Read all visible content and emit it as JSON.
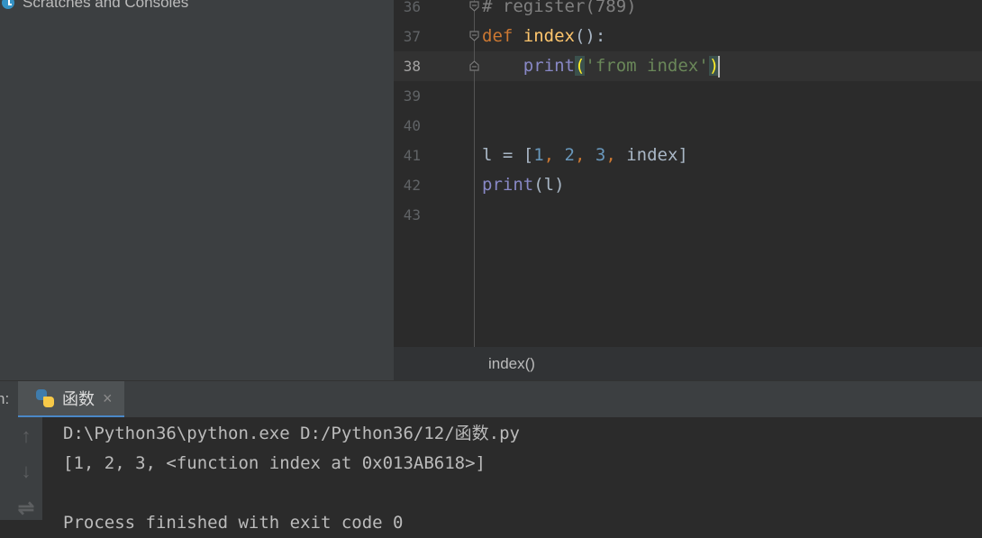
{
  "project": {
    "tree_item_label": "Scratches and Consoles",
    "tree_item_icon": "scratches-icon"
  },
  "editor": {
    "line_numbers": [
      "36",
      "37",
      "38",
      "39",
      "40",
      "41",
      "42",
      "43"
    ],
    "current_line": "38",
    "lines": [
      {
        "number": "36",
        "tokens": [
          {
            "t": "# register(789)",
            "c": "cmt"
          }
        ]
      },
      {
        "number": "37",
        "tokens": [
          {
            "t": "def",
            "c": "kw"
          },
          {
            "t": " "
          },
          {
            "t": "index",
            "c": "fn"
          },
          {
            "t": "():"
          }
        ]
      },
      {
        "number": "38",
        "tokens": [
          {
            "t": "    "
          },
          {
            "t": "print",
            "c": "bi"
          },
          {
            "t": "(",
            "c": "br"
          },
          {
            "t": "'from index'",
            "c": "str"
          },
          {
            "t": ")",
            "c": "br"
          }
        ]
      },
      {
        "number": "39",
        "tokens": []
      },
      {
        "number": "40",
        "tokens": []
      },
      {
        "number": "41",
        "tokens": [
          {
            "t": "l = ["
          },
          {
            "t": "1",
            "c": "num"
          },
          {
            "t": ", ",
            "c": "kw"
          },
          {
            "t": "2",
            "c": "num"
          },
          {
            "t": ", ",
            "c": "kw"
          },
          {
            "t": "3",
            "c": "num"
          },
          {
            "t": ", ",
            "c": "kw"
          },
          {
            "t": "index]"
          }
        ]
      },
      {
        "number": "42",
        "tokens": [
          {
            "t": "print",
            "c": "bi"
          },
          {
            "t": "(l)"
          }
        ]
      },
      {
        "number": "43",
        "tokens": []
      }
    ],
    "breadcrumb": "index()"
  },
  "run": {
    "label": "n:",
    "tab_label": "函数",
    "tab_close": "×",
    "tab_icon": "python-icon",
    "tool_icons": [
      "up-arrow-icon",
      "down-arrow-icon",
      "soft-wrap-icon"
    ],
    "tool_glyphs": [
      "↑",
      "↓",
      "⇌"
    ],
    "console_lines": [
      "D:\\Python36\\python.exe D:/Python36/12/函数.py",
      "[1, 2, 3, <function index at 0x013AB618>]",
      "",
      "Process finished with exit code 0"
    ]
  },
  "colors": {
    "accent": "#4a88c7",
    "background": "#2b2b2b",
    "panel": "#3c3f41"
  }
}
